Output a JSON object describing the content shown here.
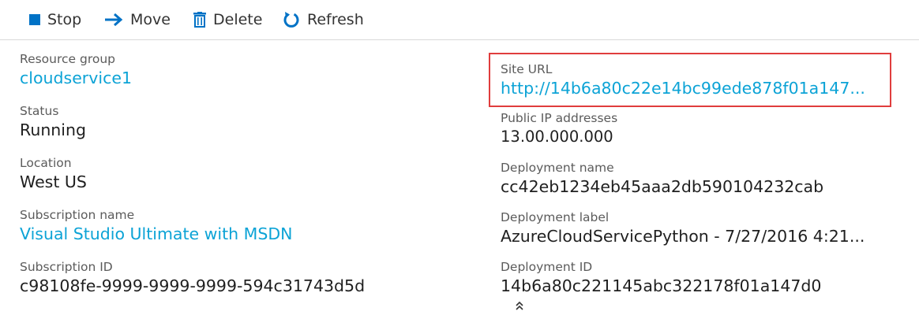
{
  "toolbar": {
    "stop_label": "Stop",
    "move_label": "Move",
    "delete_label": "Delete",
    "refresh_label": "Refresh",
    "stop_icon": "stop-square-icon",
    "move_icon": "arrow-right-icon",
    "delete_icon": "trash-icon",
    "refresh_icon": "refresh-icon",
    "icon_color": "#0072c6"
  },
  "essentials": {
    "left": {
      "resource_group_label": "Resource group",
      "resource_group_value": "cloudservice1",
      "status_label": "Status",
      "status_value": "Running",
      "location_label": "Location",
      "location_value": "West US",
      "subscription_name_label": "Subscription name",
      "subscription_name_value": "Visual Studio Ultimate with MSDN",
      "subscription_id_label": "Subscription ID",
      "subscription_id_value": "c98108fe-9999-9999-9999-594c31743d5d"
    },
    "right": {
      "site_url_label": "Site URL",
      "site_url_value": "http://14b6a80c22e14bc99ede878f01a147...",
      "public_ip_label": "Public IP addresses",
      "public_ip_value": "13.00.000.000",
      "deployment_name_label": "Deployment name",
      "deployment_name_value": "cc42eb1234eb45aaa2db590104232cab",
      "deployment_label_label": "Deployment label",
      "deployment_label_value": "AzureCloudServicePython - 7/27/2016 4:21...",
      "deployment_id_label": "Deployment ID",
      "deployment_id_value": "14b6a80c221145abc322178f01a147d0"
    }
  },
  "colors": {
    "link": "#0ca3d6",
    "highlight_border": "#e03d3d",
    "label": "#5b5b5b",
    "value": "#1f1f1f"
  },
  "collapse_icon": "double-chevron-up-icon"
}
